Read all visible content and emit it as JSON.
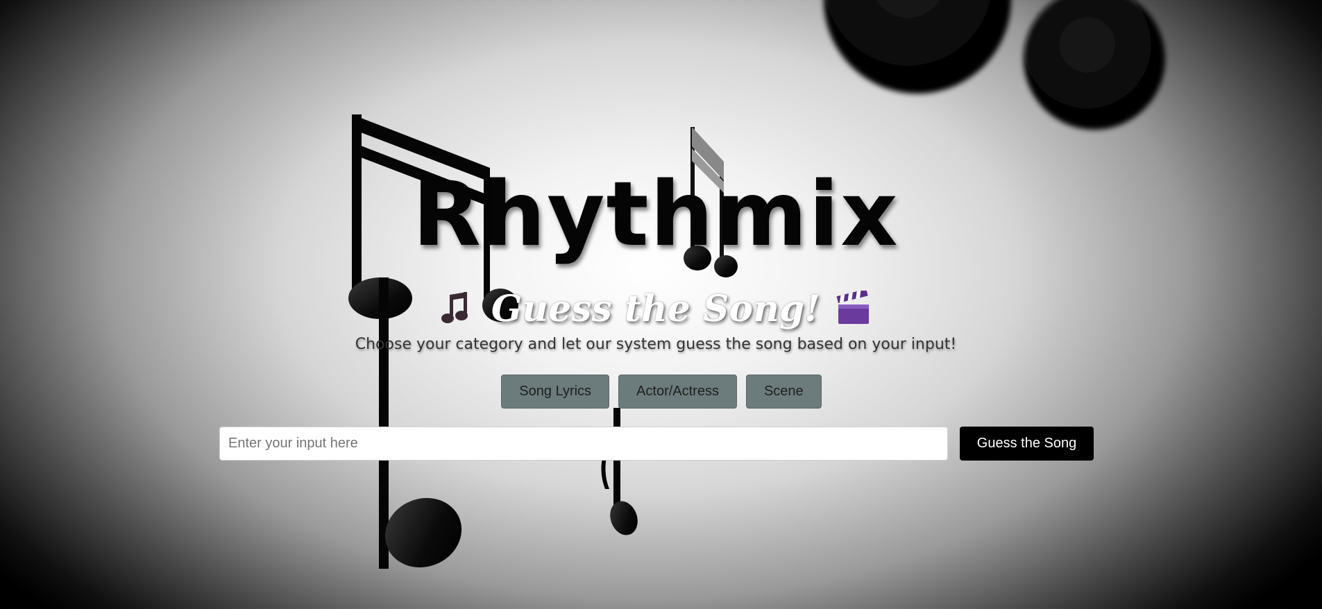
{
  "app": {
    "title": "Rhythmix",
    "subtitle": "Guess the Song!",
    "subtitle_left_icon": "musical-notes-icon",
    "subtitle_right_icon": "clapper-board-icon",
    "tagline": "Choose your category and let our system guess the song based on your input!"
  },
  "categories": [
    {
      "label": "Song Lyrics"
    },
    {
      "label": "Actor/Actress"
    },
    {
      "label": "Scene"
    }
  ],
  "search": {
    "placeholder": "Enter your input here",
    "value": ""
  },
  "actions": {
    "guess_label": "Guess the Song"
  },
  "colors": {
    "category_button": "#6c7b7b",
    "guess_button": "#000000",
    "title": "#050505",
    "subtitle": "#ffffff"
  }
}
